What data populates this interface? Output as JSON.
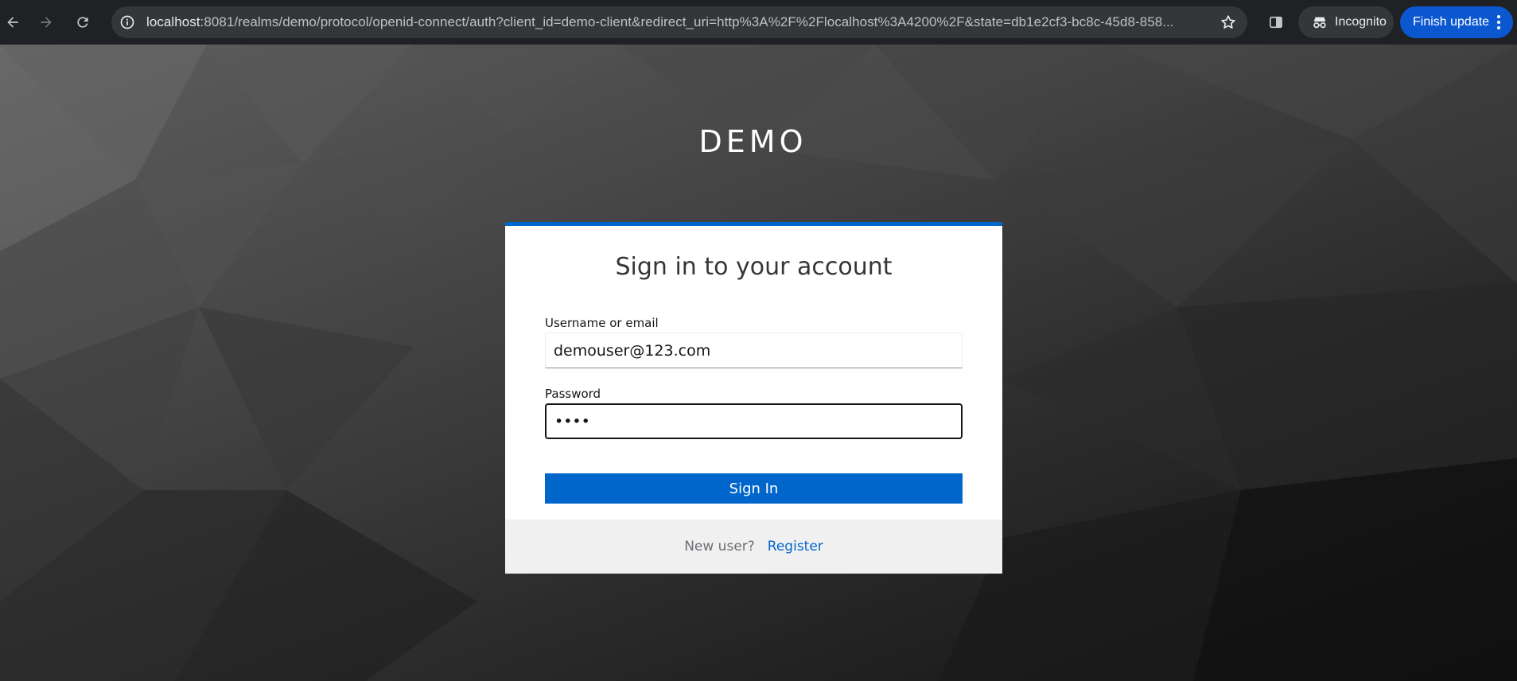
{
  "browser": {
    "url_host": "localhost",
    "url_rest": ":8081/realms/demo/protocol/openid-connect/auth?client_id=demo-client&redirect_uri=http%3A%2F%2Flocalhost%3A4200%2F&state=db1e2cf3-bc8c-45d8-858...",
    "incognito_label": "Incognito",
    "update_label": "Finish update",
    "icons": [
      "back-icon",
      "forward-icon",
      "reload-icon",
      "site-info-icon",
      "star-icon",
      "side-panel-icon",
      "incognito-icon",
      "more-vert-icon"
    ],
    "update_color": "#0b57d0"
  },
  "page": {
    "realm_title": "DEMO",
    "heading": "Sign in to your account",
    "username": {
      "label": "Username or email",
      "value": "demouser@123.com"
    },
    "password": {
      "label": "Password",
      "value": "••••"
    },
    "signin_label": "Sign In",
    "footer": {
      "new_user_text": "New user?",
      "register_label": "Register"
    },
    "accent_color": "#0066cc"
  }
}
